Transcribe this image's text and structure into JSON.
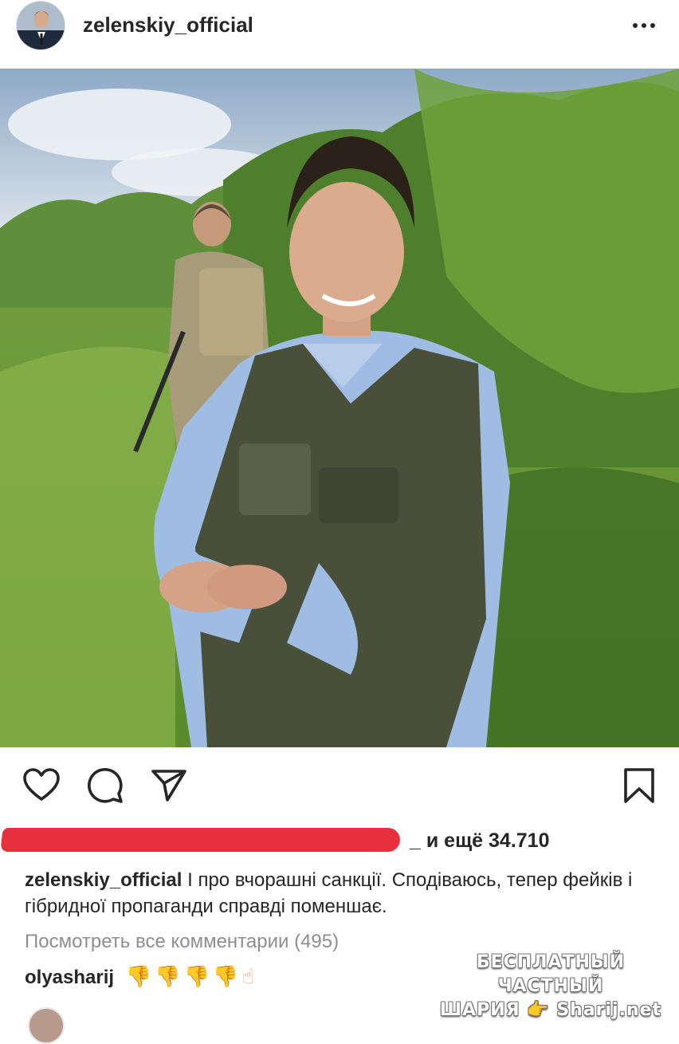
{
  "post": {
    "username": "zelenskiy_official",
    "likes_text": "_ и ещё 34.710",
    "caption_user": "zelenskiy_official",
    "caption_text": "І про вчорашні санкції. Сподіваюсь, тепер фейків і гібридної пропаганди справді поменшає.",
    "view_all_comments": "Посмотреть все комментарии (495)",
    "comment_user": "olyasharij",
    "comment_emojis": "👎👎👎👎☝"
  },
  "watermark": {
    "line1": "БЕСПЛАТНЫЙ ЧАСТНЫЙ",
    "line2": "ШАРИЯ 👉 Sharij.net"
  },
  "icons": {
    "more": "more-horizontal-icon",
    "like": "heart-icon",
    "comment": "comment-bubble-icon",
    "share": "paper-plane-icon",
    "save": "bookmark-icon"
  },
  "colors": {
    "text": "#262626",
    "secondary_text": "#8e8e8e",
    "redaction": "#e8303c"
  }
}
